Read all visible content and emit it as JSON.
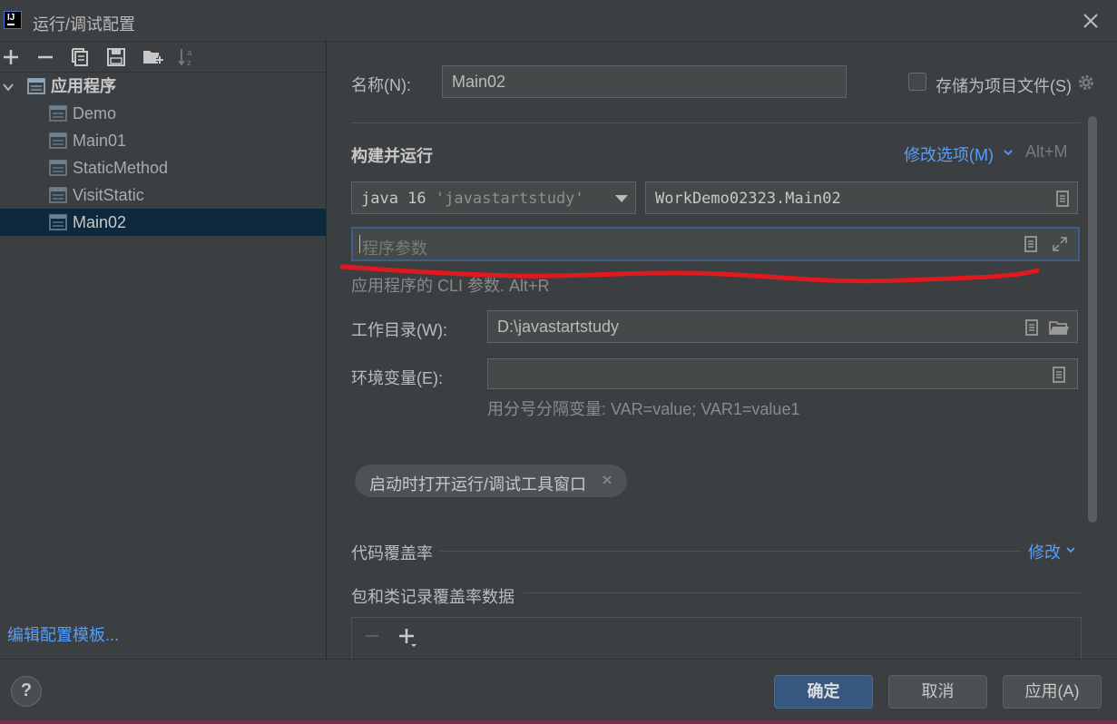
{
  "window": {
    "title": "运行/调试配置",
    "logo_text": "IJ"
  },
  "tree": {
    "root_label": "应用程序",
    "children": [
      "Demo",
      "Main01",
      "StaticMethod",
      "VisitStatic",
      "Main02"
    ],
    "selected": "Main02"
  },
  "left_footer": {
    "edit_templates": "编辑配置模板..."
  },
  "form": {
    "name_label": "名称(N):",
    "name_value": "Main02",
    "store_label": "存储为项目文件(S)",
    "build_section": "构建并运行",
    "modify_options": "修改选项(M)",
    "modify_shortcut": "Alt+M",
    "jdk_value": "java 16 ",
    "jdk_project": "'javastartstudy'",
    "main_class": "WorkDemo02323.Main02",
    "program_args_placeholder": "程序参数",
    "args_hint": "应用程序的 CLI 参数. Alt+R",
    "workdir_label": "工作目录(W):",
    "workdir_value": "D:\\javastartstudy",
    "env_label": "环境变量(E):",
    "env_value": "",
    "env_hint": "用分号分隔变量: VAR=value; VAR1=value1",
    "chip_label": "启动时打开运行/调试工具窗口",
    "coverage_label": "代码覆盖率",
    "coverage_modify": "修改",
    "pkg_label": "包和类记录覆盖率数据"
  },
  "buttons": {
    "help": "?",
    "ok": "确定",
    "cancel": "取消",
    "apply": "应用(A)"
  },
  "colors": {
    "accent": "#589df6",
    "selection": "#0d293e",
    "primary_button": "#365880",
    "annotation": "#e0191e"
  }
}
